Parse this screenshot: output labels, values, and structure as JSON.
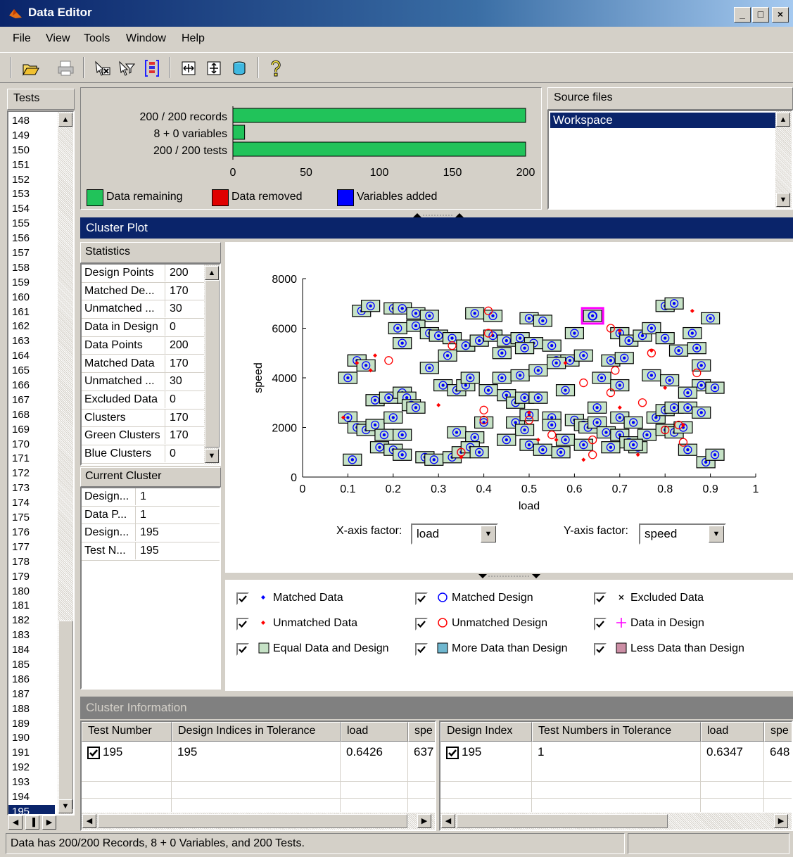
{
  "window": {
    "title": "Data Editor",
    "buttons": [
      "_",
      "□",
      "×"
    ]
  },
  "menu": [
    "File",
    "View",
    "Tools",
    "Window",
    "Help"
  ],
  "toolbar_icons": [
    "open-folder-icon",
    "print-icon",
    "remove-data-icon",
    "filter-icon",
    "variable-icon",
    "expand-horizontal-icon",
    "expand-vertical-icon",
    "database-icon",
    "help-icon"
  ],
  "tests": {
    "header": "Tests",
    "items": [
      "148",
      "149",
      "150",
      "151",
      "152",
      "153",
      "154",
      "155",
      "156",
      "157",
      "158",
      "159",
      "160",
      "161",
      "162",
      "163",
      "164",
      "165",
      "166",
      "167",
      "168",
      "169",
      "170",
      "171",
      "172",
      "173",
      "174",
      "175",
      "176",
      "177",
      "178",
      "179",
      "180",
      "181",
      "182",
      "183",
      "184",
      "185",
      "186",
      "187",
      "188",
      "189",
      "190",
      "191",
      "192",
      "193",
      "194",
      "195"
    ],
    "selected": "195"
  },
  "summary": {
    "rows": [
      {
        "label": "200 / 200 records",
        "value": 200
      },
      {
        "label": "8 + 0 variables",
        "value": 8
      },
      {
        "label": "200 / 200 tests",
        "value": 200
      }
    ],
    "axis_ticks": [
      "0",
      "50",
      "100",
      "150",
      "200"
    ],
    "axis_max": 200,
    "legend": [
      {
        "label": "Data remaining",
        "color": "#21c35a"
      },
      {
        "label": "Data removed",
        "color": "#e00000"
      },
      {
        "label": "Variables added",
        "color": "#0000ff"
      }
    ]
  },
  "source_files": {
    "header": "Source files",
    "items": [
      "Workspace"
    ]
  },
  "cluster_plot": {
    "header": "Cluster Plot"
  },
  "statistics": {
    "header": "Statistics",
    "rows": [
      {
        "k": "Design Points",
        "v": "200"
      },
      {
        "k": "Matched De...",
        "v": "170"
      },
      {
        "k": "Unmatched ...",
        "v": "30"
      },
      {
        "k": "Data in Design",
        "v": "0"
      },
      {
        "k": "Data Points",
        "v": "200"
      },
      {
        "k": "Matched Data",
        "v": "170"
      },
      {
        "k": "Unmatched ...",
        "v": "30"
      },
      {
        "k": "Excluded Data",
        "v": "0"
      },
      {
        "k": "Clusters",
        "v": "170"
      },
      {
        "k": "Green Clusters",
        "v": "170"
      },
      {
        "k": "Blue Clusters",
        "v": "0"
      }
    ]
  },
  "current_cluster": {
    "header": "Current Cluster",
    "rows": [
      {
        "k": "Design...",
        "v": "1"
      },
      {
        "k": "Data P...",
        "v": "1"
      },
      {
        "k": "Design...",
        "v": "195"
      },
      {
        "k": "Test N...",
        "v": "195"
      }
    ]
  },
  "chart_data": {
    "type": "scatter",
    "xlabel": "load",
    "ylabel": "speed",
    "xlim": [
      0,
      1
    ],
    "ylim": [
      0,
      8000
    ],
    "xticks": [
      "0",
      "0.1",
      "0.2",
      "0.3",
      "0.4",
      "0.5",
      "0.6",
      "0.7",
      "0.8",
      "0.9",
      "1"
    ],
    "yticks": [
      "0",
      "2000",
      "4000",
      "6000",
      "8000"
    ],
    "selected_cluster": {
      "x": 0.64,
      "y": 6500
    },
    "matched": [
      [
        0.1,
        4000
      ],
      [
        0.12,
        4700
      ],
      [
        0.13,
        6700
      ],
      [
        0.15,
        6900
      ],
      [
        0.2,
        6800
      ],
      [
        0.22,
        6800
      ],
      [
        0.25,
        6600
      ],
      [
        0.28,
        6500
      ],
      [
        0.38,
        6600
      ],
      [
        0.42,
        6500
      ],
      [
        0.5,
        6400
      ],
      [
        0.53,
        6300
      ],
      [
        0.64,
        6500
      ],
      [
        0.8,
        6900
      ],
      [
        0.82,
        7000
      ],
      [
        0.9,
        6400
      ],
      [
        0.21,
        6000
      ],
      [
        0.25,
        6100
      ],
      [
        0.28,
        5800
      ],
      [
        0.3,
        5700
      ],
      [
        0.33,
        5600
      ],
      [
        0.36,
        5300
      ],
      [
        0.39,
        5500
      ],
      [
        0.42,
        5700
      ],
      [
        0.45,
        5500
      ],
      [
        0.48,
        5600
      ],
      [
        0.51,
        5400
      ],
      [
        0.55,
        5300
      ],
      [
        0.6,
        5800
      ],
      [
        0.7,
        5800
      ],
      [
        0.72,
        5500
      ],
      [
        0.75,
        5700
      ],
      [
        0.77,
        6000
      ],
      [
        0.8,
        5600
      ],
      [
        0.86,
        5800
      ],
      [
        0.22,
        5400
      ],
      [
        0.32,
        4900
      ],
      [
        0.44,
        5000
      ],
      [
        0.49,
        5200
      ],
      [
        0.56,
        4700
      ],
      [
        0.59,
        4700
      ],
      [
        0.62,
        4900
      ],
      [
        0.68,
        4700
      ],
      [
        0.71,
        4800
      ],
      [
        0.83,
        5100
      ],
      [
        0.87,
        5200
      ],
      [
        0.88,
        4500
      ],
      [
        0.12,
        4700
      ],
      [
        0.14,
        4500
      ],
      [
        0.28,
        4400
      ],
      [
        0.44,
        4000
      ],
      [
        0.48,
        4100
      ],
      [
        0.52,
        4300
      ],
      [
        0.56,
        4600
      ],
      [
        0.66,
        4000
      ],
      [
        0.7,
        3700
      ],
      [
        0.77,
        4100
      ],
      [
        0.81,
        3900
      ],
      [
        0.88,
        3700
      ],
      [
        0.91,
        3600
      ],
      [
        0.85,
        3400
      ],
      [
        0.1,
        4000
      ],
      [
        0.16,
        3100
      ],
      [
        0.19,
        3200
      ],
      [
        0.22,
        3400
      ],
      [
        0.23,
        3200
      ],
      [
        0.24,
        2900
      ],
      [
        0.25,
        2800
      ],
      [
        0.31,
        3700
      ],
      [
        0.34,
        3500
      ],
      [
        0.36,
        3700
      ],
      [
        0.37,
        4000
      ],
      [
        0.41,
        3500
      ],
      [
        0.45,
        3300
      ],
      [
        0.47,
        3000
      ],
      [
        0.49,
        3200
      ],
      [
        0.52,
        3200
      ],
      [
        0.55,
        2400
      ],
      [
        0.58,
        3500
      ],
      [
        0.65,
        2800
      ],
      [
        0.7,
        2400
      ],
      [
        0.73,
        2200
      ],
      [
        0.78,
        2400
      ],
      [
        0.8,
        2700
      ],
      [
        0.82,
        2800
      ],
      [
        0.85,
        2800
      ],
      [
        0.88,
        2600
      ],
      [
        0.1,
        2400
      ],
      [
        0.12,
        2000
      ],
      [
        0.14,
        1900
      ],
      [
        0.16,
        2100
      ],
      [
        0.18,
        1700
      ],
      [
        0.2,
        2400
      ],
      [
        0.22,
        1700
      ],
      [
        0.34,
        1800
      ],
      [
        0.38,
        1600
      ],
      [
        0.4,
        2200
      ],
      [
        0.47,
        2200
      ],
      [
        0.49,
        1900
      ],
      [
        0.5,
        2500
      ],
      [
        0.55,
        2100
      ],
      [
        0.58,
        1500
      ],
      [
        0.6,
        2300
      ],
      [
        0.62,
        2100
      ],
      [
        0.63,
        2000
      ],
      [
        0.65,
        2200
      ],
      [
        0.67,
        1800
      ],
      [
        0.7,
        1700
      ],
      [
        0.72,
        1400
      ],
      [
        0.74,
        1200
      ],
      [
        0.76,
        1700
      ],
      [
        0.8,
        1900
      ],
      [
        0.82,
        1800
      ],
      [
        0.84,
        2000
      ],
      [
        0.11,
        700
      ],
      [
        0.17,
        1200
      ],
      [
        0.2,
        1100
      ],
      [
        0.22,
        900
      ],
      [
        0.27,
        800
      ],
      [
        0.29,
        700
      ],
      [
        0.33,
        800
      ],
      [
        0.35,
        1000
      ],
      [
        0.37,
        1200
      ],
      [
        0.39,
        1000
      ],
      [
        0.45,
        1500
      ],
      [
        0.5,
        1300
      ],
      [
        0.53,
        1100
      ],
      [
        0.57,
        1000
      ],
      [
        0.62,
        1300
      ],
      [
        0.68,
        1200
      ],
      [
        0.73,
        1300
      ],
      [
        0.85,
        1100
      ],
      [
        0.89,
        600
      ],
      [
        0.91,
        900
      ]
    ],
    "unmatched_data": [
      [
        0.09,
        2400
      ],
      [
        0.12,
        4600
      ],
      [
        0.16,
        4900
      ],
      [
        0.15,
        4300
      ],
      [
        0.3,
        2900
      ],
      [
        0.35,
        800
      ],
      [
        0.5,
        2600
      ],
      [
        0.52,
        1500
      ],
      [
        0.56,
        1500
      ],
      [
        0.58,
        4600
      ],
      [
        0.62,
        700
      ],
      [
        0.7,
        5900
      ],
      [
        0.7,
        2800
      ],
      [
        0.74,
        900
      ],
      [
        0.77,
        5100
      ],
      [
        0.8,
        3600
      ],
      [
        0.84,
        2100
      ],
      [
        0.86,
        6700
      ]
    ],
    "unmatched_design": [
      [
        0.19,
        4700
      ],
      [
        0.33,
        5300
      ],
      [
        0.35,
        1000
      ],
      [
        0.4,
        2700
      ],
      [
        0.41,
        6700
      ],
      [
        0.4,
        2300
      ],
      [
        0.41,
        5800
      ],
      [
        0.5,
        2300
      ],
      [
        0.55,
        1700
      ],
      [
        0.62,
        3800
      ],
      [
        0.64,
        1500
      ],
      [
        0.64,
        900
      ],
      [
        0.68,
        6000
      ],
      [
        0.68,
        3400
      ],
      [
        0.69,
        4300
      ],
      [
        0.75,
        3000
      ],
      [
        0.77,
        5000
      ],
      [
        0.8,
        1900
      ],
      [
        0.83,
        2100
      ],
      [
        0.84,
        1400
      ],
      [
        0.87,
        4200
      ]
    ]
  },
  "axis_factors": {
    "x_label": "X-axis factor:",
    "x_value": "load",
    "y_label": "Y-axis factor:",
    "y_value": "speed"
  },
  "plot_legend": [
    {
      "label": "Matched Data",
      "glyph": "dot",
      "color": "#0000ff"
    },
    {
      "label": "Matched Design",
      "glyph": "circle",
      "color": "#0000ff"
    },
    {
      "label": "Excluded Data",
      "glyph": "x",
      "color": "#000000"
    },
    {
      "label": "Unmatched Data",
      "glyph": "dot",
      "color": "#ff0000"
    },
    {
      "label": "Unmatched Design",
      "glyph": "circle",
      "color": "#ff0000"
    },
    {
      "label": "Data in Design",
      "glyph": "plus",
      "color": "#ff00ff"
    },
    {
      "label": "Equal Data and Design",
      "glyph": "square",
      "color": "#c6e2c6"
    },
    {
      "label": "More Data than Design",
      "glyph": "square",
      "color": "#6fb7cf"
    },
    {
      "label": "Less Data than Design",
      "glyph": "square",
      "color": "#cc8ea5"
    }
  ],
  "cluster_info": {
    "header": "Cluster Information",
    "left_columns": [
      "Test Number",
      "Design Indices in Tolerance",
      "load",
      "spe"
    ],
    "left_row": [
      "195",
      "195",
      "0.6426",
      "637"
    ],
    "right_columns": [
      "Design Index",
      "Test Numbers in Tolerance",
      "load",
      "spe"
    ],
    "right_row": [
      "195",
      "1",
      "0.6347",
      "648"
    ]
  },
  "status": "Data has 200/200 Records, 8 + 0 Variables, and 200 Tests."
}
